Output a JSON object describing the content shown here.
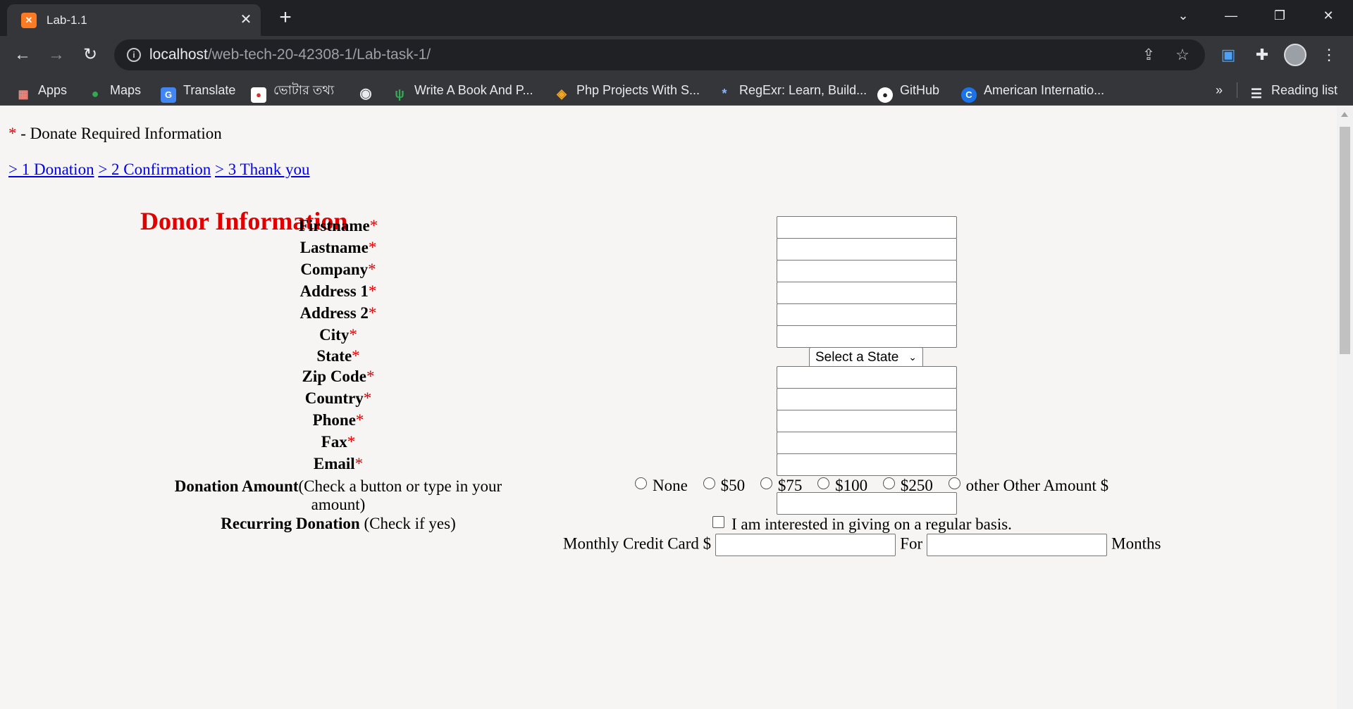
{
  "browser": {
    "tab_title": "Lab-1.1",
    "url_host": "localhost",
    "url_path": "/web-tech-20-42308-1/Lab-task-1/",
    "bookmarks": [
      "Apps",
      "Maps",
      "Translate",
      "ভোটার তথ্য",
      "Write A Book And P...",
      "Php Projects With S...",
      "RegExr: Learn, Build...",
      "GitHub",
      "American Internatio..."
    ],
    "reading_list": "Reading list",
    "overflow": "»"
  },
  "page": {
    "required_asterisk": "*",
    "required_note": " - Donate Required Information",
    "steps": [
      "> 1 Donation",
      "> 2 Confirmation",
      "> 3 Thank you"
    ],
    "section_title": "Donor Information",
    "fields": [
      {
        "label": "Firstname",
        "required": "*"
      },
      {
        "label": "Lastname",
        "required": "*"
      },
      {
        "label": "Company",
        "required": "*"
      },
      {
        "label": "Address 1",
        "required": "*"
      },
      {
        "label": "Address 2",
        "required": "*"
      },
      {
        "label": "City",
        "required": "*"
      },
      {
        "label": "State",
        "required": "*"
      },
      {
        "label": "Zip Code",
        "required": "*"
      },
      {
        "label": "Country",
        "required": "*"
      },
      {
        "label": "Phone",
        "required": "*"
      },
      {
        "label": "Fax",
        "required": "*"
      },
      {
        "label": "Email",
        "required": "*"
      }
    ],
    "state_select_value": "Select a State",
    "donation_label": "Donation Amount",
    "donation_hint": "(Check a button or type in your amount)",
    "donation_options": [
      "None",
      "$50",
      "$75",
      "$100",
      "$250",
      "other"
    ],
    "other_amount_label": "Other Amount $",
    "recurring_label": "Recurring Donation",
    "recurring_hint": " (Check if yes)",
    "recurring_checkbox_text": "I am interested in giving on a regular basis.",
    "monthly_label": "Monthly Credit Card $",
    "for_label": "For",
    "months_label": "Months"
  }
}
